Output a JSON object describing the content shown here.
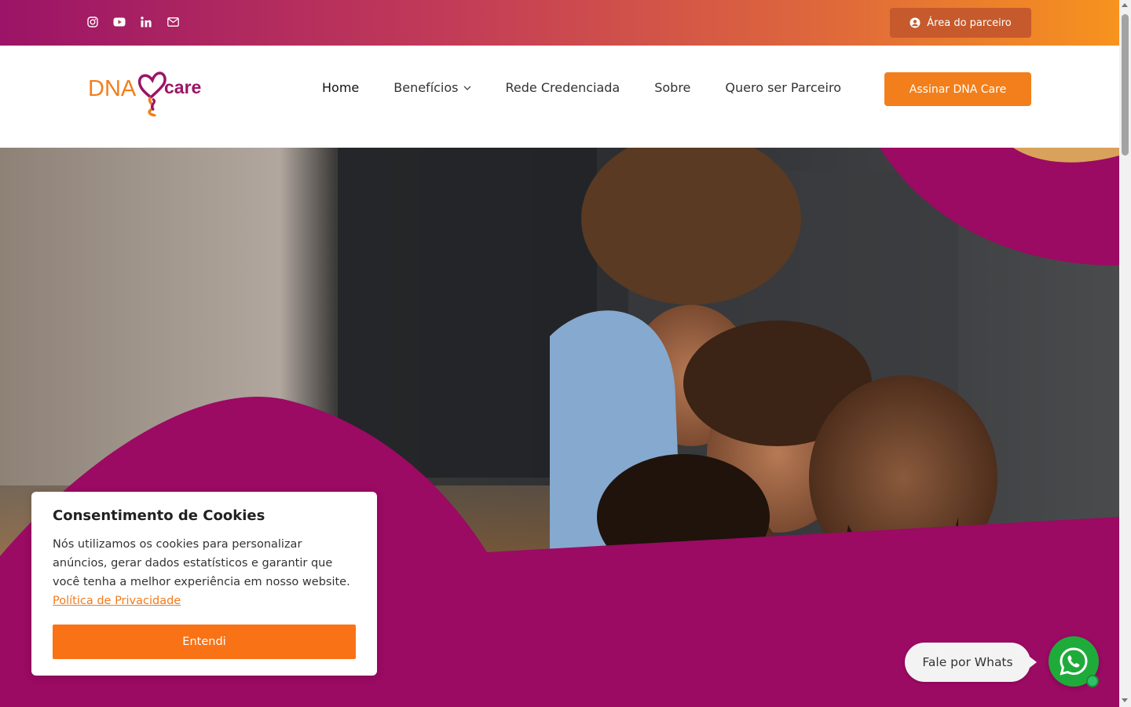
{
  "topbar": {
    "social_icons": [
      "instagram-icon",
      "youtube-icon",
      "linkedin-icon",
      "mail-icon"
    ],
    "partner_label": "Área do parceiro"
  },
  "header": {
    "logo_text_left": "DNA",
    "logo_text_right": "care",
    "nav": [
      {
        "label": "Home",
        "active": true
      },
      {
        "label": "Benefícios",
        "has_dropdown": true
      },
      {
        "label": "Rede Credenciada"
      },
      {
        "label": "Sobre"
      },
      {
        "label": "Quero ser Parceiro"
      }
    ],
    "cta_label": "Assinar DNA Care"
  },
  "cookie": {
    "title": "Consentimento de Cookies",
    "text": "Nós utilizamos os cookies para personalizar anúncios, gerar dados estatísticos e garantir que você tenha a melhor experiência em nosso website.",
    "link_label": "Política de Privacidade",
    "button_label": "Entendi"
  },
  "whatsapp": {
    "label": "Fale por Whats"
  },
  "colors": {
    "brand_purple": "#9b0a63",
    "brand_orange": "#f27f1b"
  }
}
